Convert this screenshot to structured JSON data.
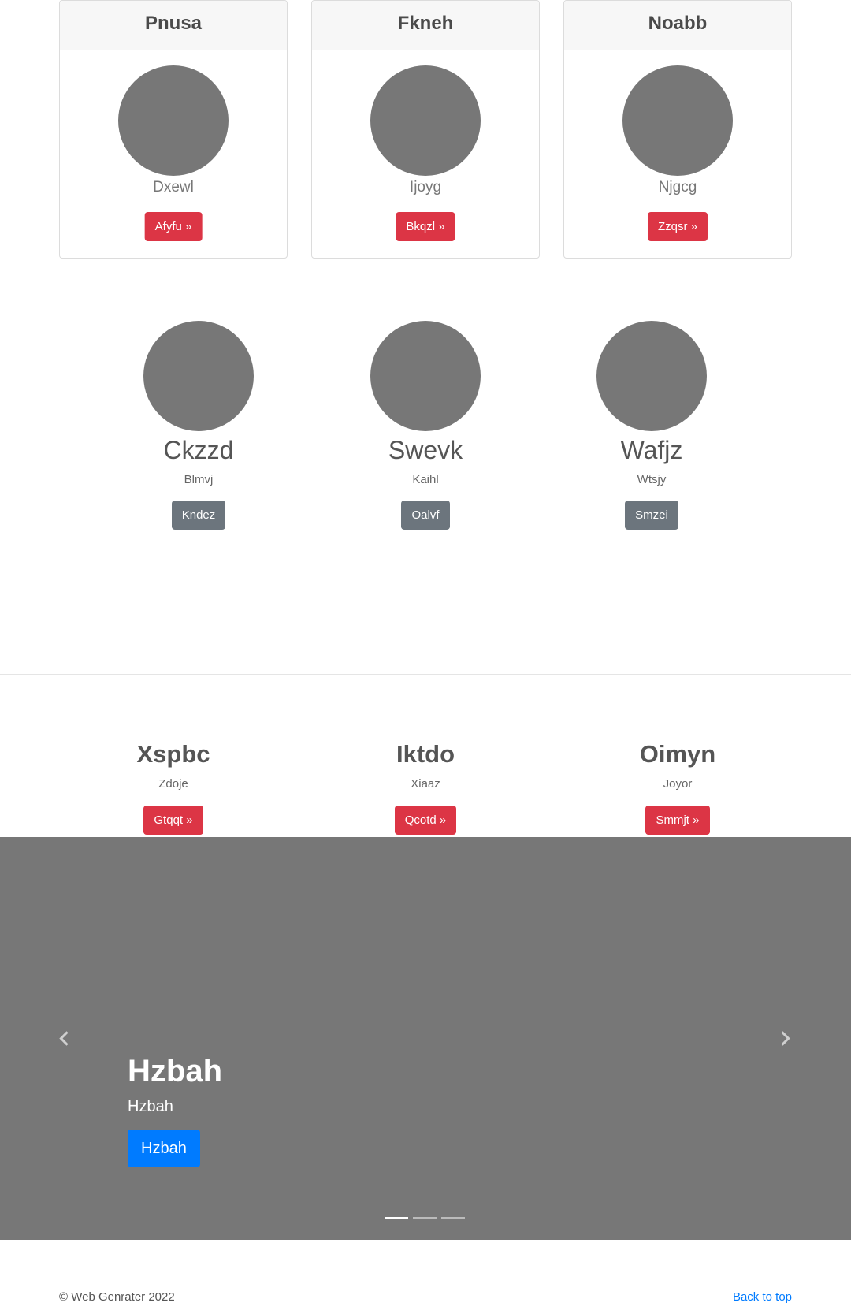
{
  "cards": [
    {
      "title": "Pnusa",
      "text": "Dxewl",
      "button": "Afyfu »"
    },
    {
      "title": "Fkneh",
      "text": "Ijoyg",
      "button": "Bkqzl »"
    },
    {
      "title": "Noabb",
      "text": "Njgcg",
      "button": "Zzqsr »"
    }
  ],
  "features": [
    {
      "heading": "Ckzzd",
      "sub": "Blmvj",
      "button": "Kndez"
    },
    {
      "heading": "Swevk",
      "sub": "Kaihl",
      "button": "Oalvf"
    },
    {
      "heading": "Wafjz",
      "sub": "Wtsjy",
      "button": "Smzei"
    }
  ],
  "columns": [
    {
      "heading": "Xspbc",
      "sub": "Zdoje",
      "button": "Gtqqt »"
    },
    {
      "heading": "Iktdo",
      "sub": "Xiaaz",
      "button": "Qcotd »"
    },
    {
      "heading": "Oimyn",
      "sub": "Joyor",
      "button": "Smmjt »"
    }
  ],
  "carousel": {
    "heading": "Hzbah",
    "sub": "Hzbah",
    "button": "Hzbah",
    "prev_icon": "chevron-left-icon",
    "next_icon": "chevron-right-icon",
    "slide_count": 3,
    "active_index": 0
  },
  "footer": {
    "copyright": "© Web Genrater 2022",
    "back_to_top": "Back to top"
  },
  "colors": {
    "placeholder_gray": "#777777",
    "danger": "#dc3545",
    "secondary": "#6c757d",
    "primary": "#007bff"
  }
}
